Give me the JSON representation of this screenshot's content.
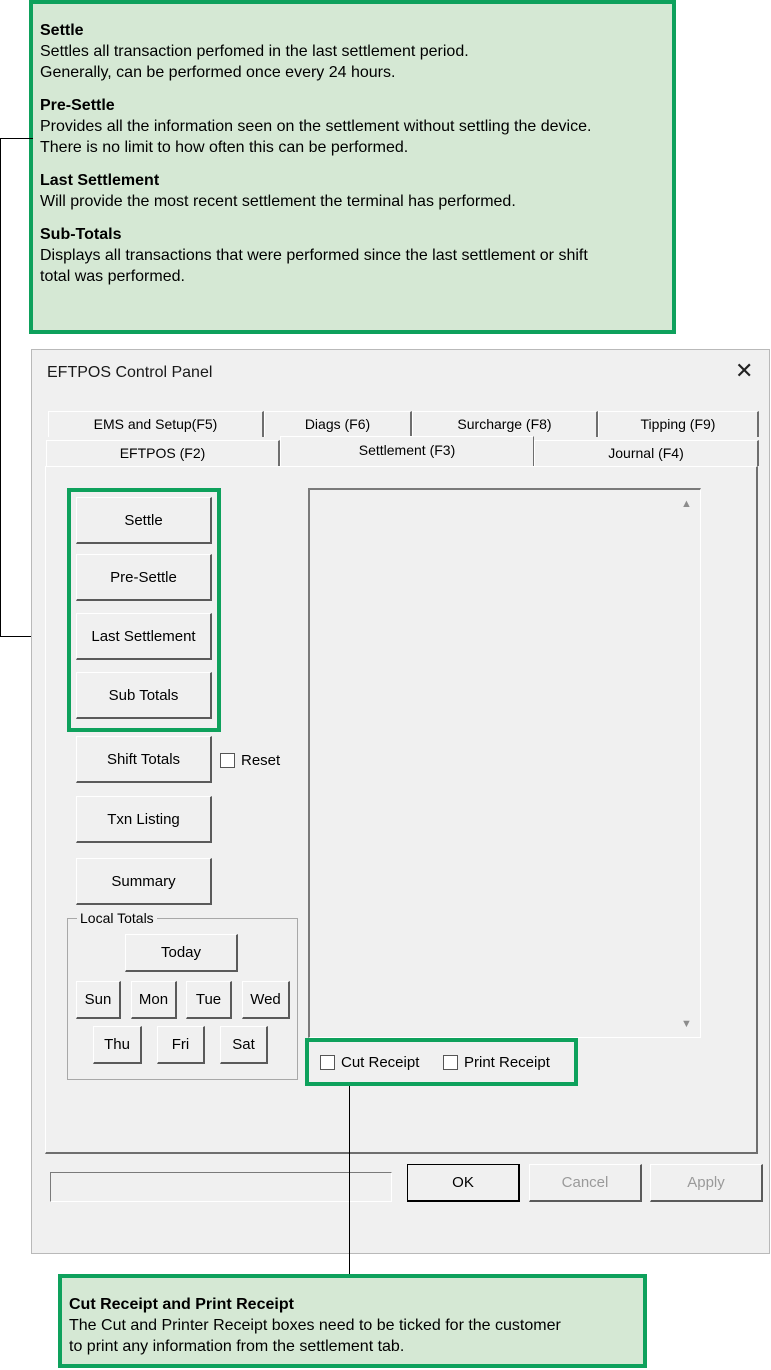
{
  "notes": {
    "top": [
      {
        "heading": "Settle",
        "lines": [
          "Settles all transaction perfomed in the last settlement period.",
          "Generally, can be performed once every 24 hours."
        ]
      },
      {
        "heading": "Pre-Settle",
        "lines": [
          "Provides all the information seen on the settlement without settling the device.",
          "There is no limit to how often this can be performed."
        ]
      },
      {
        "heading": "Last Settlement",
        "lines": [
          "Will provide the most recent settlement the terminal has performed."
        ]
      },
      {
        "heading": "Sub-Totals",
        "lines": [
          "Displays all transactions that were performed since the last settlement or shift",
          "total was performed."
        ]
      }
    ],
    "bottom": {
      "heading": "Cut Receipt and Print Receipt",
      "lines": [
        "The Cut and Printer Receipt boxes need to be ticked for the customer",
        "to print any information from the settlement tab."
      ]
    }
  },
  "dialog": {
    "title": "EFTPOS Control Panel",
    "close": "✕",
    "tabs_back": [
      "EMS and Setup(F5)",
      "Diags (F6)",
      "Surcharge (F8)",
      "Tipping (F9)"
    ],
    "tabs_front": [
      "EFTPOS (F2)",
      "Settlement (F3)",
      "Journal (F4)"
    ],
    "active_tab": "Settlement (F3)",
    "buttons": {
      "settle": "Settle",
      "pre_settle": "Pre-Settle",
      "last_settlement": "Last Settlement",
      "sub_totals": "Sub Totals",
      "shift_totals": "Shift Totals",
      "txn_listing": "Txn Listing",
      "summary": "Summary"
    },
    "reset_label": "Reset",
    "local_totals": {
      "label": "Local Totals",
      "today": "Today",
      "days": [
        "Sun",
        "Mon",
        "Tue",
        "Wed",
        "Thu",
        "Fri",
        "Sat"
      ]
    },
    "receipts": {
      "cut": "Cut Receipt",
      "print": "Print Receipt"
    },
    "footer": {
      "ok": "OK",
      "cancel": "Cancel",
      "apply": "Apply"
    },
    "scroll_up": "▲",
    "scroll_down": "▼"
  },
  "colors": {
    "accent": "#0ea15c",
    "note_bg": "#d5e8d4",
    "dialog_bg": "#f0f0f0"
  }
}
